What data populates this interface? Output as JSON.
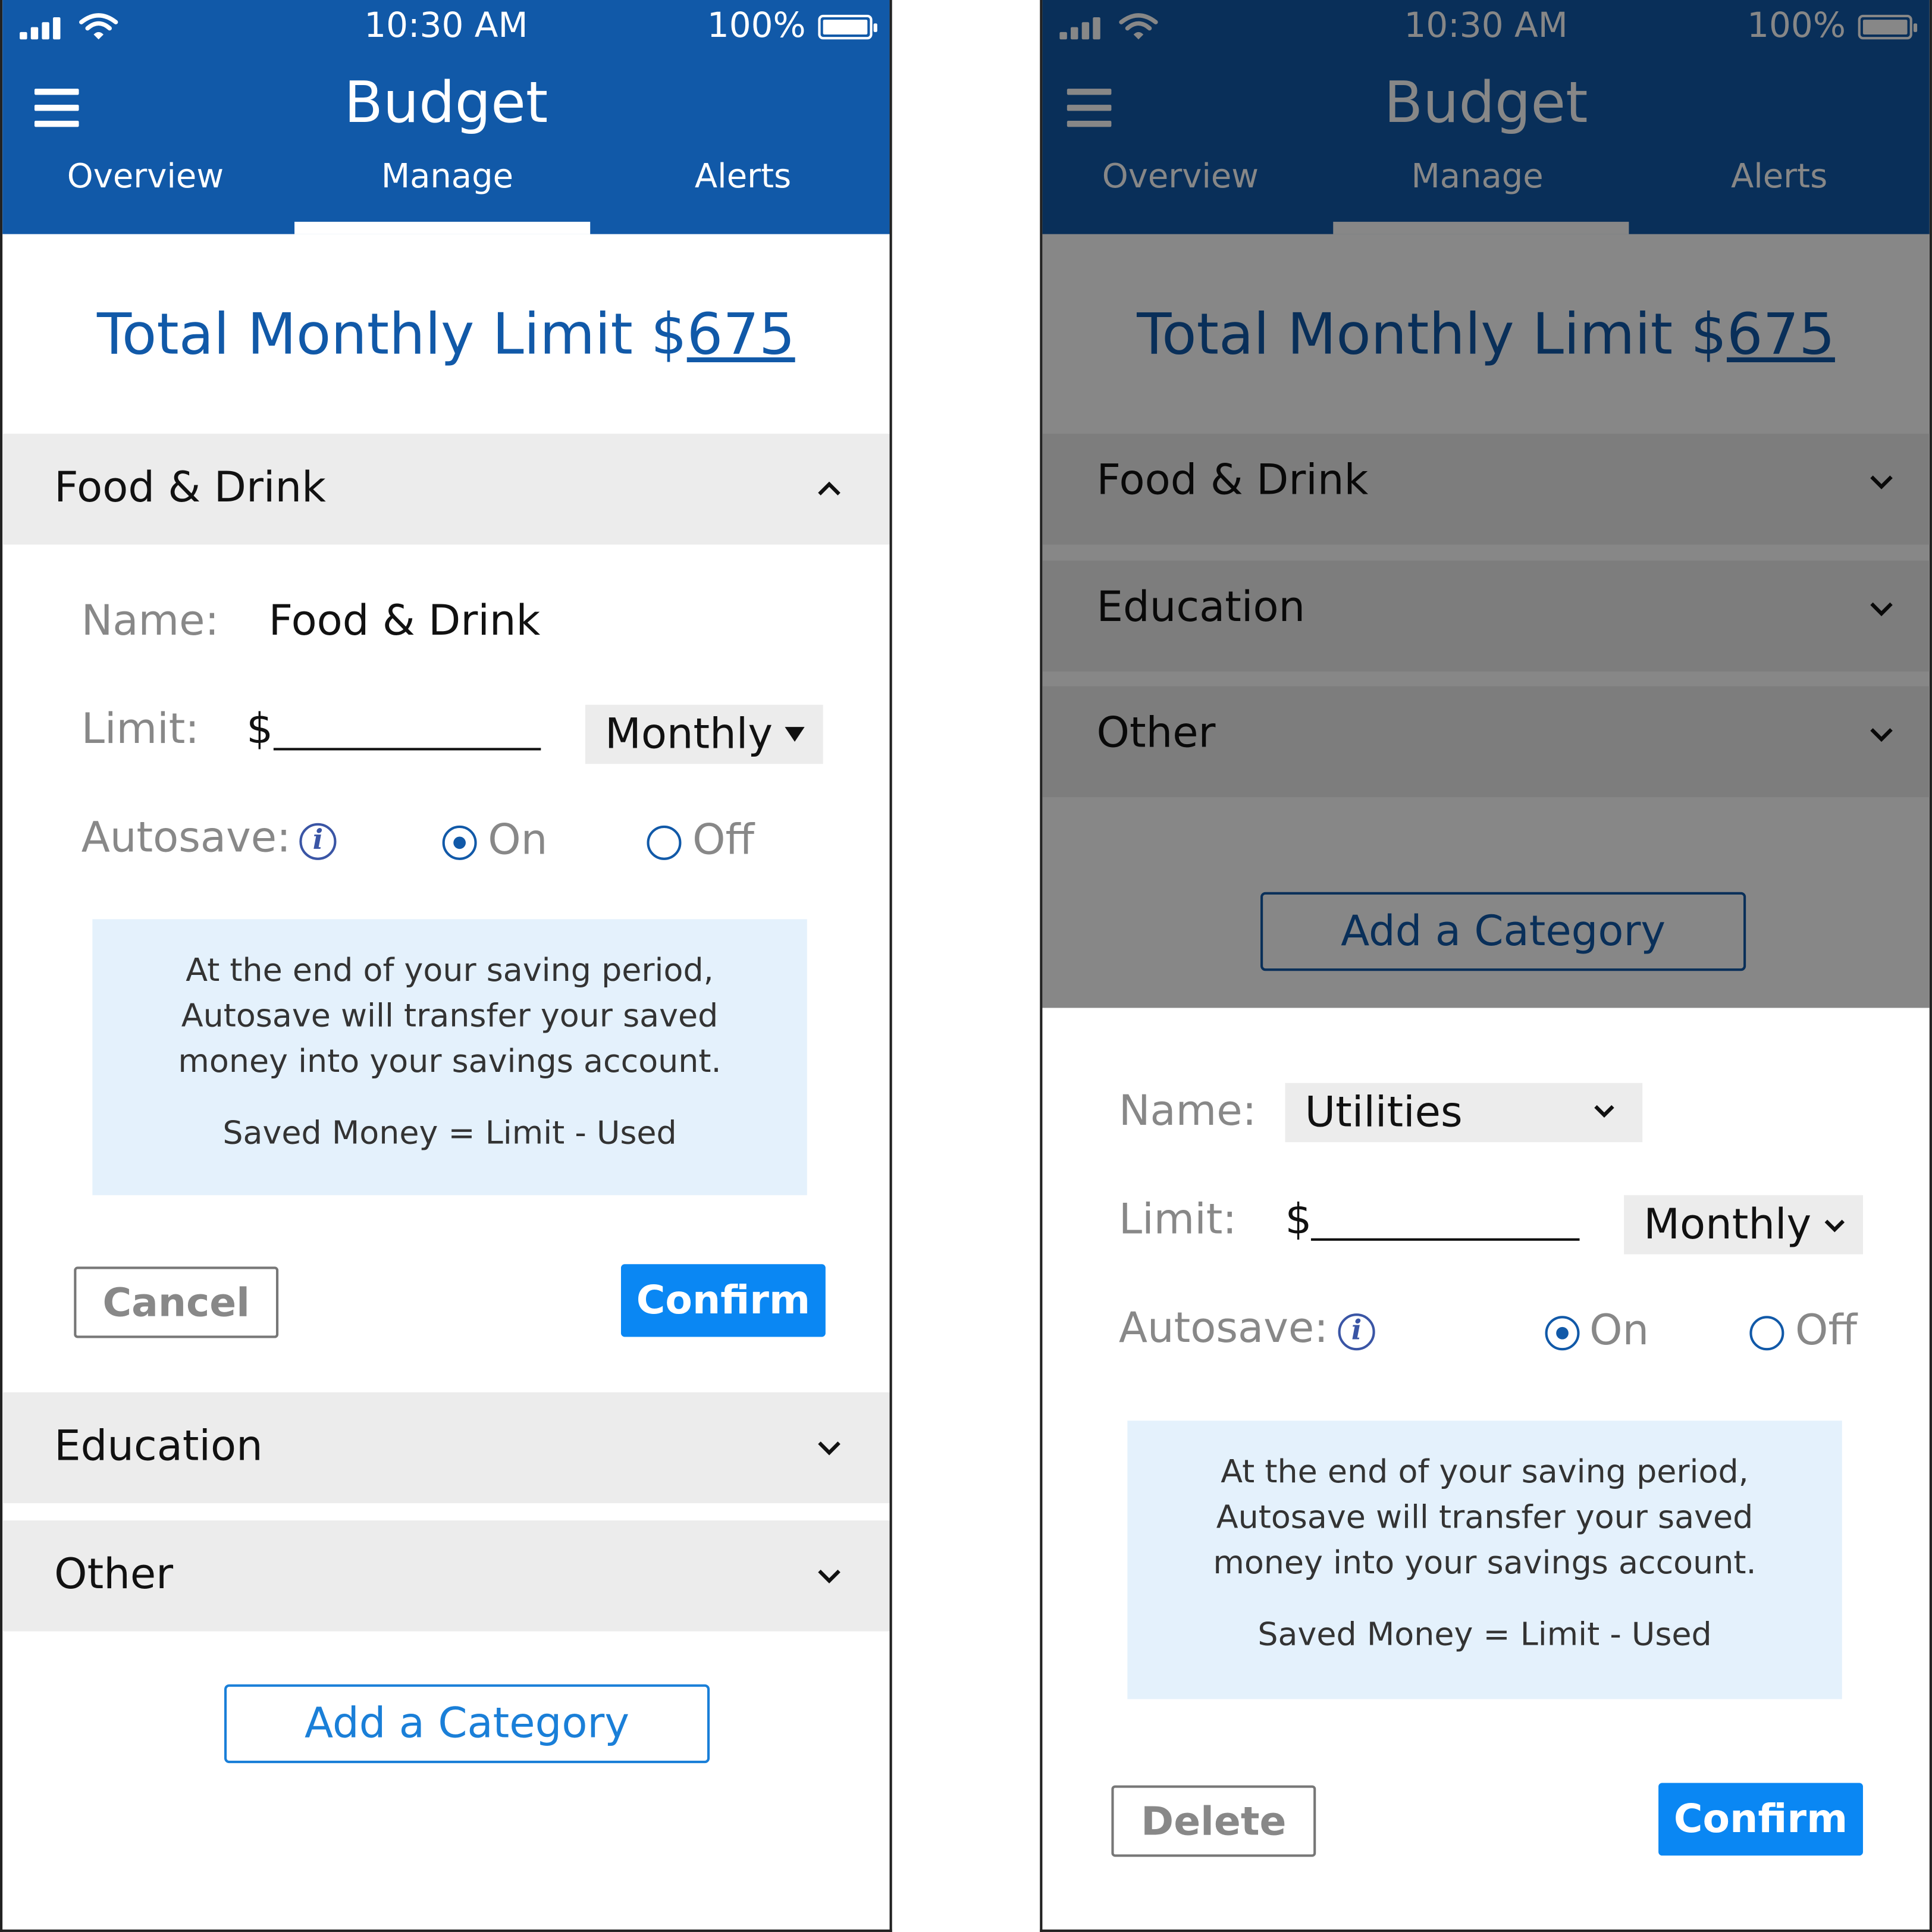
{
  "status": {
    "time": "10:30 AM",
    "battery": "100%"
  },
  "app": {
    "title": "Budget"
  },
  "tabs": [
    "Overview",
    "Manage",
    "Alerts"
  ],
  "total": {
    "label": "Total Monthly Limit $",
    "amount": "675"
  },
  "left": {
    "expanded_category": "Food & Drink",
    "form": {
      "name_label": "Name:",
      "name_value": "Food & Drink",
      "limit_label": "Limit:",
      "limit_currency": "$",
      "period": "Monthly",
      "autosave_label": "Autosave:",
      "info_glyph": "i",
      "on_label": "On",
      "off_label": "Off",
      "autosave_selected": "On"
    },
    "info": {
      "line1": "At the end of your saving period,",
      "line2": "Autosave will transfer your saved",
      "line3": "money into your savings account.",
      "formula": "Saved Money = Limit - Used"
    },
    "cancel_label": "Cancel",
    "confirm_label": "Confirm",
    "categories": [
      "Education",
      "Other"
    ],
    "add_label": "Add a Category"
  },
  "right": {
    "categories": [
      "Food & Drink",
      "Education",
      "Other"
    ],
    "add_label": "Add a Category",
    "form": {
      "name_label": "Name:",
      "name_value": "Utilities",
      "limit_label": "Limit:",
      "limit_currency": "$",
      "period": "Monthly",
      "autosave_label": "Autosave:",
      "info_glyph": "i",
      "on_label": "On",
      "off_label": "Off",
      "autosave_selected": "On"
    },
    "info": {
      "line1": "At the end of your saving period,",
      "line2": "Autosave will transfer your saved",
      "line3": "money into your savings account.",
      "formula": "Saved Money = Limit - Used"
    },
    "delete_label": "Delete",
    "confirm_label": "Confirm"
  },
  "colors": {
    "brand": "#1159a8",
    "primary_button": "#0a87f3",
    "info_bg": "#e4f1fc",
    "accordion_bg": "#ececec"
  },
  "icons": [
    "signal-icon",
    "wifi-icon",
    "battery-icon",
    "menu-icon",
    "chevron-up-icon",
    "chevron-down-icon",
    "info-icon",
    "caret-down-icon"
  ]
}
